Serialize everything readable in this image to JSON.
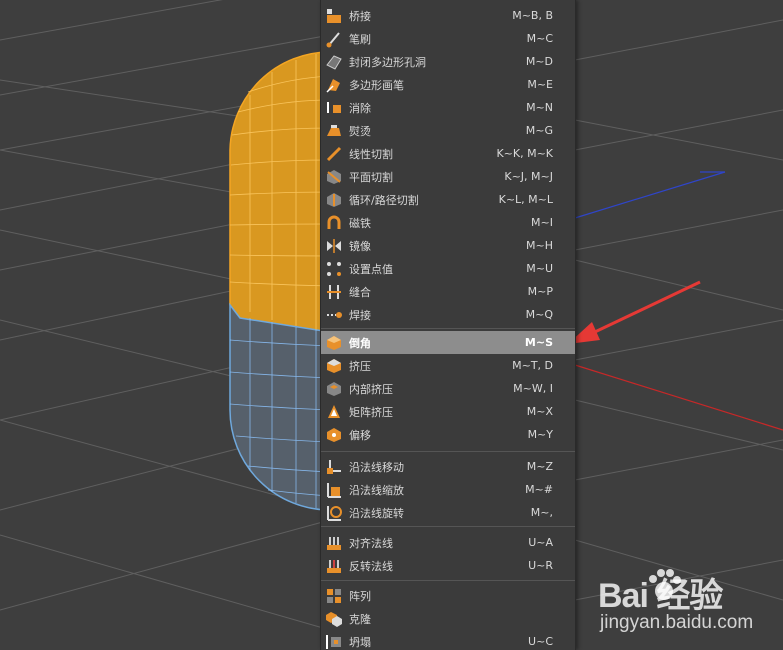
{
  "menu": {
    "items": [
      {
        "label": "桥接",
        "shortcut": "M~B, B",
        "icon": "bridge-icon",
        "highlighted": false
      },
      {
        "label": "笔刷",
        "shortcut": "M~C",
        "icon": "brush-icon",
        "highlighted": false
      },
      {
        "label": "封闭多边形孔洞",
        "shortcut": "M~D",
        "icon": "close-hole-icon",
        "highlighted": false
      },
      {
        "label": "多边形画笔",
        "shortcut": "M~E",
        "icon": "polygon-pen-icon",
        "highlighted": false
      },
      {
        "label": "消除",
        "shortcut": "M~N",
        "icon": "dissolve-icon",
        "highlighted": false
      },
      {
        "label": "熨烫",
        "shortcut": "M~G",
        "icon": "iron-icon",
        "highlighted": false
      },
      {
        "label": "线性切割",
        "shortcut": "K~K, M~K",
        "icon": "knife-icon",
        "highlighted": false
      },
      {
        "label": "平面切割",
        "shortcut": "K~J, M~J",
        "icon": "plane-cut-icon",
        "highlighted": false
      },
      {
        "label": "循环/路径切割",
        "shortcut": "K~L, M~L",
        "icon": "loop-cut-icon",
        "highlighted": false
      },
      {
        "label": "磁铁",
        "shortcut": "M~I",
        "icon": "magnet-icon",
        "highlighted": false
      },
      {
        "label": "镜像",
        "shortcut": "M~H",
        "icon": "mirror-icon",
        "highlighted": false
      },
      {
        "label": "设置点值",
        "shortcut": "M~U",
        "icon": "set-point-value-icon",
        "highlighted": false
      },
      {
        "label": "缝合",
        "shortcut": "M~P",
        "icon": "stitch-icon",
        "highlighted": false
      },
      {
        "label": "焊接",
        "shortcut": "M~Q",
        "icon": "weld-icon",
        "highlighted": false
      },
      {
        "label": "倒角",
        "shortcut": "M~S",
        "icon": "bevel-icon",
        "highlighted": true
      },
      {
        "label": "挤压",
        "shortcut": "M~T, D",
        "icon": "extrude-icon",
        "highlighted": false
      },
      {
        "label": "内部挤压",
        "shortcut": "M~W, I",
        "icon": "extrude-inner-icon",
        "highlighted": false
      },
      {
        "label": "矩阵挤压",
        "shortcut": "M~X",
        "icon": "matrix-extrude-icon",
        "highlighted": false
      },
      {
        "label": "偏移",
        "shortcut": "M~Y",
        "icon": "offset-icon",
        "highlighted": false
      },
      {
        "label": "沿法线移动",
        "shortcut": "M~Z",
        "icon": "normal-move-icon",
        "highlighted": false
      },
      {
        "label": "沿法线缩放",
        "shortcut": "M~#",
        "icon": "normal-scale-icon",
        "highlighted": false
      },
      {
        "label": "沿法线旋转",
        "shortcut": "M~,",
        "icon": "normal-rotate-icon",
        "highlighted": false
      },
      {
        "label": "对齐法线",
        "shortcut": "U~A",
        "icon": "align-normals-icon",
        "highlighted": false
      },
      {
        "label": "反转法线",
        "shortcut": "U~R",
        "icon": "reverse-normals-icon",
        "highlighted": false
      },
      {
        "label": "阵列",
        "shortcut": "",
        "icon": "array-icon",
        "highlighted": false
      },
      {
        "label": "克隆",
        "shortcut": "",
        "icon": "clone-icon",
        "highlighted": false
      },
      {
        "label": "坍塌",
        "shortcut": "U~C",
        "icon": "collapse-icon",
        "highlighted": false
      }
    ]
  },
  "watermark": {
    "logo": "Bai 经验",
    "url": "jingyan.baidu.com"
  },
  "colors": {
    "viewport_bg": "#3e3e3e",
    "grid_line": "#6a6a6a",
    "selected_mesh": "#f5a623",
    "unselected_mesh": "#6fa8dc",
    "annotation_arrow": "#e53935",
    "menu_highlight": "#8d8d8d",
    "icon_accent": "#e8902a"
  }
}
